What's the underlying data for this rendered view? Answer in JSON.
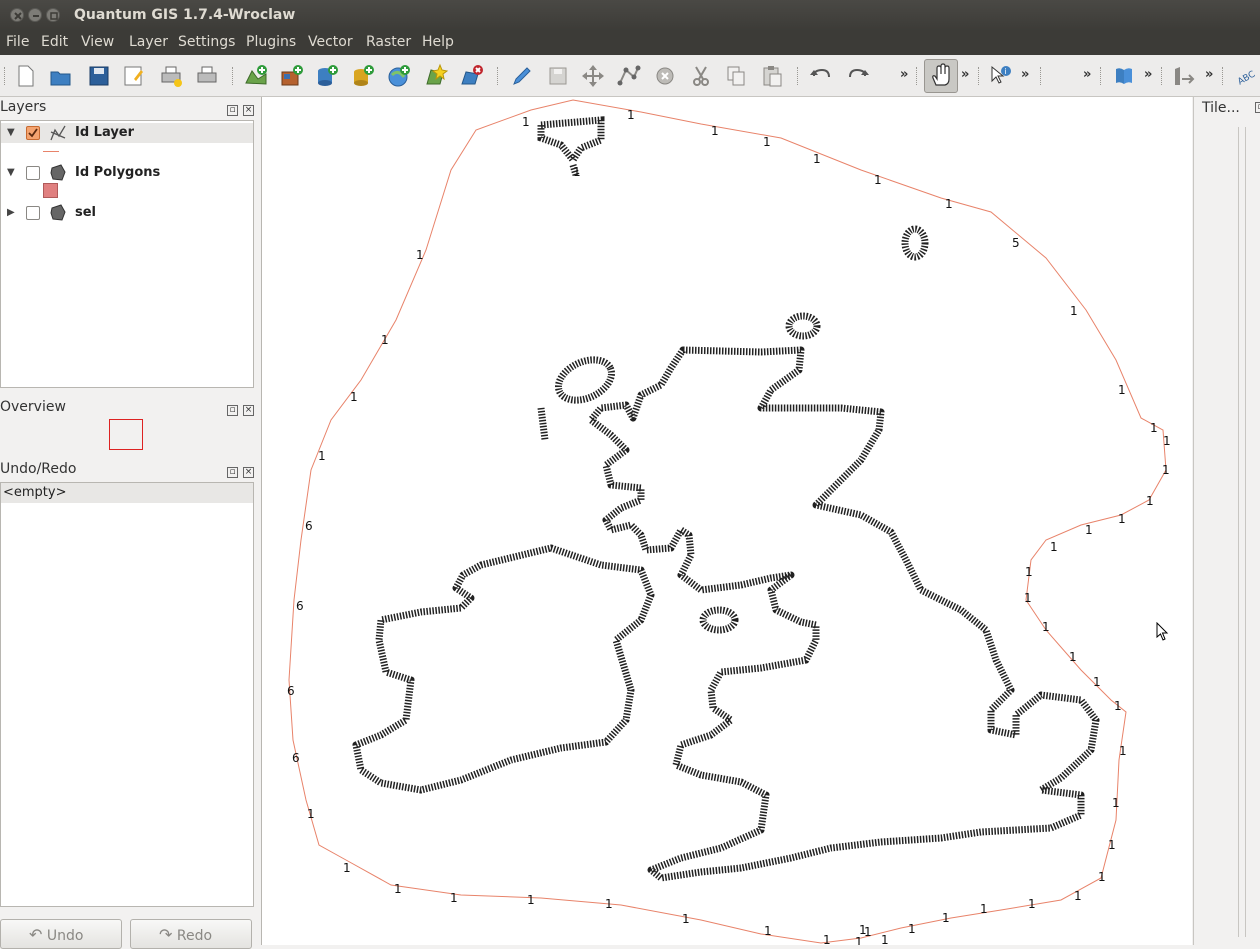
{
  "window": {
    "title": "Quantum GIS 1.7.4-Wroclaw"
  },
  "menu": [
    "File",
    "Edit",
    "View",
    "Layer",
    "Settings",
    "Plugins",
    "Vector",
    "Raster",
    "Help"
  ],
  "toolbar": {
    "overflow": "»"
  },
  "panels": {
    "layers": "Layers",
    "overview": "Overview",
    "undo_redo": "Undo/Redo",
    "tile": "Tile..."
  },
  "layers": [
    {
      "name": "Id Layer",
      "checked": true,
      "expanded": true
    },
    {
      "name": "Id Polygons",
      "checked": false,
      "expanded": true
    },
    {
      "name": "sel",
      "checked": false,
      "expanded": false
    }
  ],
  "undo": {
    "empty": "<empty>",
    "undo_label": "Undo",
    "redo_label": "Redo"
  },
  "map": {
    "boundary_color": "#e8836a",
    "labels": [
      "1",
      "1",
      "1",
      "1",
      "1",
      "1",
      "1",
      "5",
      "1",
      "1",
      "1",
      "1",
      "1",
      "1",
      "1",
      "1",
      "1",
      "1",
      "1",
      "1",
      "1",
      "1",
      "1",
      "1",
      "1",
      "1",
      "1",
      "1",
      "1",
      "1",
      "1",
      "1",
      "1",
      "1",
      "1",
      "1",
      "1",
      "1",
      "1",
      "1",
      "1",
      "1",
      "6",
      "6",
      "6",
      "6",
      "1",
      "1",
      "1",
      "1",
      "1",
      "1",
      "1",
      "1"
    ]
  }
}
